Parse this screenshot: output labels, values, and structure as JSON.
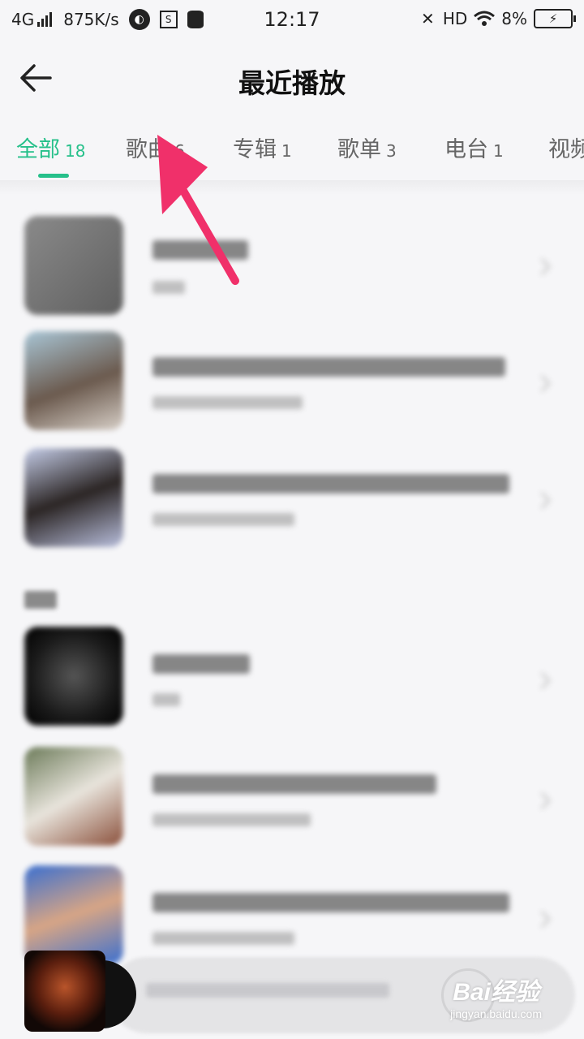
{
  "status_bar": {
    "network": "4G",
    "speed": "875K/s",
    "time": "12:17",
    "hd": "HD",
    "battery": "8%",
    "icons": [
      "signal-icon",
      "app-icon",
      "s-box-icon",
      "database-icon",
      "mute-icon",
      "wifi-icon",
      "battery-icon"
    ]
  },
  "header": {
    "title": "最近播放",
    "back_icon": "arrow-left-icon"
  },
  "tabs": [
    {
      "label": "全部",
      "count": "18",
      "active": true
    },
    {
      "label": "歌曲",
      "count": "6"
    },
    {
      "label": "专辑",
      "count": "1"
    },
    {
      "label": "歌单",
      "count": "3"
    },
    {
      "label": "电台",
      "count": "1"
    },
    {
      "label": "视频",
      "count": ""
    }
  ],
  "colors": {
    "accent": "#26c08a",
    "annotation_arrow": "#f0306a"
  },
  "watermark": {
    "main": "Bai经验",
    "sub": "jingyan.baidu.com"
  }
}
